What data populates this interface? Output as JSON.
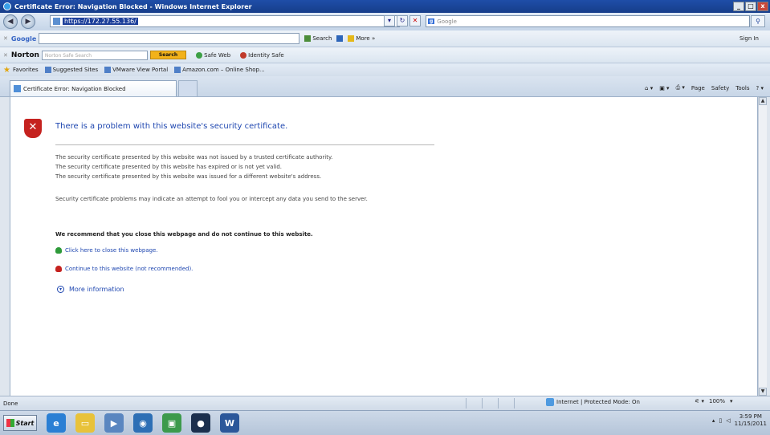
{
  "window": {
    "title": "Certificate Error: Navigation Blocked - Windows Internet Explorer",
    "minimize": "_",
    "maximize": "□",
    "close": "x"
  },
  "address": {
    "url": "https://172.27.55.136/",
    "search_placeholder": "Google",
    "search_brand": "g"
  },
  "google_toolbar": {
    "logo": "Google",
    "search": "Search",
    "more": "More »",
    "signin": "Sign In"
  },
  "norton_toolbar": {
    "logo": "Norton",
    "search_placeholder": "Norton Safe Search",
    "search_button": "Search",
    "safe_web": "Safe Web",
    "identity_safe": "Identity Safe"
  },
  "favorites": {
    "label": "Favorites",
    "items": [
      "Suggested Sites",
      "VMware View Portal",
      "Amazon.com – Online Shop..."
    ]
  },
  "tab": {
    "title": "Certificate Error: Navigation Blocked"
  },
  "commandbar": {
    "page": "Page",
    "safety": "Safety",
    "tools": "Tools"
  },
  "page": {
    "heading": "There is a problem with this website's security certificate.",
    "reasons": [
      "The security certificate presented by this website was not issued by a trusted certificate authority.",
      "The security certificate presented by this website has expired or is not yet valid.",
      "The security certificate presented by this website was issued for a different website's address."
    ],
    "warning": "Security certificate problems may indicate an attempt to fool you or intercept any data you send to the server.",
    "recommendation": "We recommend that you close this webpage and do not continue to this website.",
    "close_link": "Click here to close this webpage.",
    "continue_link": "Continue to this website (not recommended).",
    "more_info": "More information"
  },
  "statusbar": {
    "status": "Done",
    "zone": "Internet | Protected Mode: On",
    "zoom": "100%"
  },
  "taskbar": {
    "start": "Start",
    "time": "3:59 PM",
    "date": "11/15/2011"
  }
}
